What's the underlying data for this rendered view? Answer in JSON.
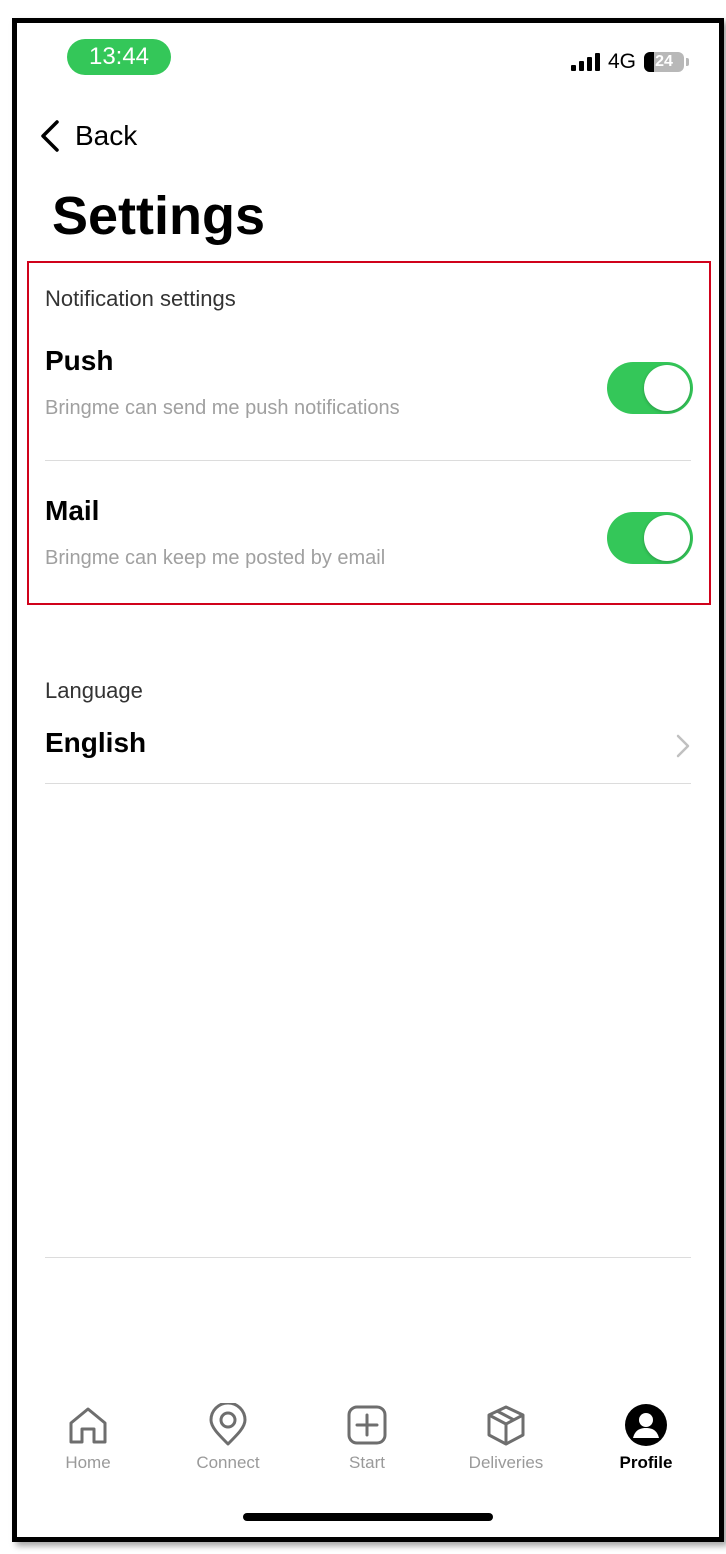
{
  "status_bar": {
    "time": "13:44",
    "network": "4G",
    "battery": "24",
    "battery_level": 0.24
  },
  "nav": {
    "back_label": "Back"
  },
  "page_title": "Settings",
  "notifications": {
    "section_label": "Notification settings",
    "push": {
      "title": "Push",
      "subtitle": "Bringme can send me push notifications",
      "enabled": true
    },
    "mail": {
      "title": "Mail",
      "subtitle": "Bringme can keep me posted by email",
      "enabled": true
    }
  },
  "language": {
    "section_label": "Language",
    "value": "English"
  },
  "tabbar": {
    "items": [
      {
        "label": "Home",
        "icon": "home-icon"
      },
      {
        "label": "Connect",
        "icon": "location-pin-icon"
      },
      {
        "label": "Start",
        "icon": "plus-square-icon"
      },
      {
        "label": "Deliveries",
        "icon": "box-icon"
      },
      {
        "label": "Profile",
        "icon": "profile-icon",
        "active": true
      }
    ]
  },
  "colors": {
    "accent_green": "#34c759",
    "highlight_red": "#d0021b",
    "muted_text": "#a0a0a0"
  }
}
